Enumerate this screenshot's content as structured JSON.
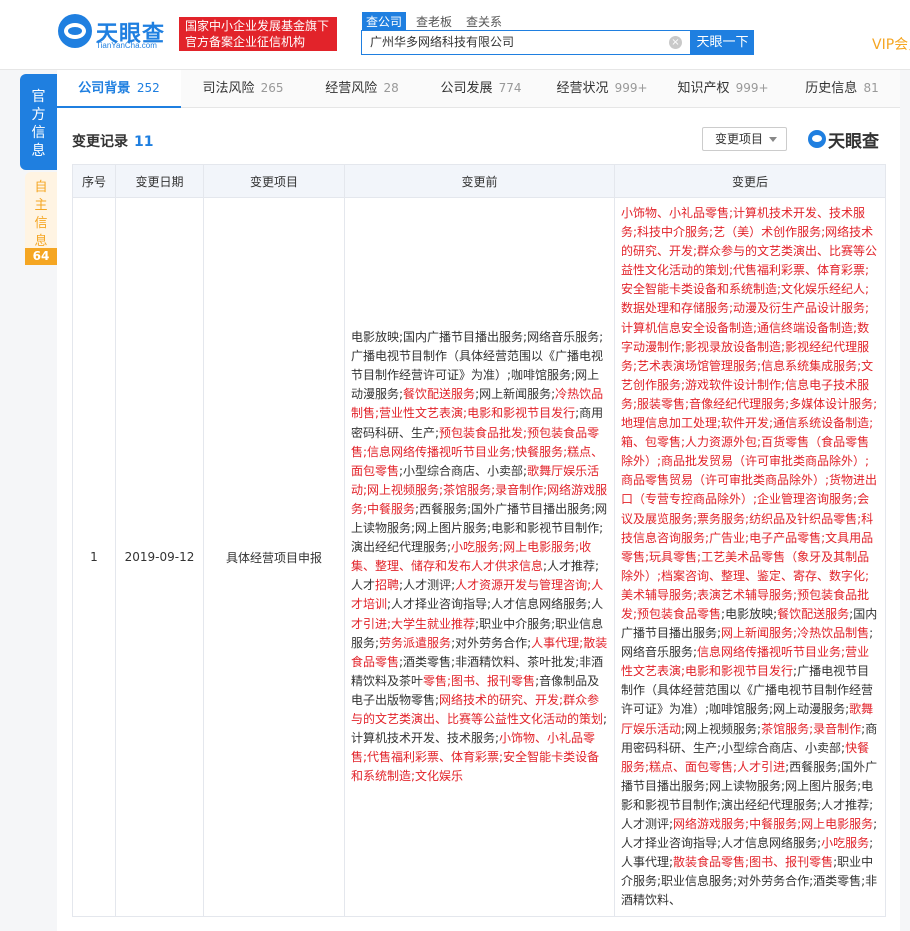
{
  "header": {
    "logo_text": "天眼查",
    "logo_sub": "TianYanCha.com",
    "badge_line1": "国家中小企业发展基金旗下",
    "badge_line2": "官方备案企业征信机构",
    "search_tabs": [
      "查公司",
      "查老板",
      "查关系"
    ],
    "search_value": "广州华多网络科技有限公司",
    "search_button": "天眼一下",
    "vip_label": "VIP会员"
  },
  "sidebar": {
    "official_label": "官方信息",
    "self_label": "自主信息",
    "self_count": "64"
  },
  "tabs": [
    {
      "label": "公司背景",
      "count": "252",
      "active": true
    },
    {
      "label": "司法风险",
      "count": "265"
    },
    {
      "label": "经营风险",
      "count": "28"
    },
    {
      "label": "公司发展",
      "count": "774"
    },
    {
      "label": "经营状况",
      "count": "999+"
    },
    {
      "label": "知识产权",
      "count": "999+"
    },
    {
      "label": "历史信息",
      "count": "81"
    }
  ],
  "section": {
    "title": "变更记录",
    "count": "11",
    "filter_label": "变更项目",
    "watermark": "天眼查"
  },
  "table": {
    "headers": [
      "序号",
      "变更日期",
      "变更项目",
      "变更前",
      "变更后"
    ],
    "rows": [
      {
        "index": "1",
        "date": "2019-09-12",
        "item": "具体经营项目申报",
        "before": [
          {
            "t": "电影放映;国内广播节目播出服务;网络音乐服务;广播电视节目制作（具体经营范围以《广播电视节目制作经营许可证》为准）;咖啡馆服务;网上动漫服务;",
            "h": false
          },
          {
            "t": "餐饮配送服务",
            "h": true
          },
          {
            "t": ";网上新闻服务;",
            "h": false
          },
          {
            "t": "冷热饮品制售;营业性文艺表演;电影和影视节目发行",
            "h": true
          },
          {
            "t": ";商用密码科研、生产;",
            "h": false
          },
          {
            "t": "预包装食品批发;预包装食品零售;信息网络传播视听节目业务;快餐服务;糕点、面包零售",
            "h": true
          },
          {
            "t": ";小型综合商店、小卖部;",
            "h": false
          },
          {
            "t": "歌舞厅娱乐活动;网上视频服务;茶馆服务;录音制作;网络游戏服务;中餐服务",
            "h": true
          },
          {
            "t": ";西餐服务;国外广播节目播出服务;网上读物服务;网上图片服务;电影和影视节目制作;演出经纪代理服务;",
            "h": false
          },
          {
            "t": "小吃服务;网上电影服务;收集、整理、储存和发布人才供求信息",
            "h": true
          },
          {
            "t": ";人才推荐;人才",
            "h": false
          },
          {
            "t": "招聘",
            "h": true
          },
          {
            "t": ";人才测评;",
            "h": false
          },
          {
            "t": "人才资源开发与管理咨询;人才培训",
            "h": true
          },
          {
            "t": ";人才择业咨询指导;人才信息网络服务;人",
            "h": false
          },
          {
            "t": "才引进;大学生就业推荐",
            "h": true
          },
          {
            "t": ";职业中介服务;职业信息服务;",
            "h": false
          },
          {
            "t": "劳务派遣服务",
            "h": true
          },
          {
            "t": ";对外劳务合作;",
            "h": false
          },
          {
            "t": "人事代理;散装食品零售",
            "h": true
          },
          {
            "t": ";酒类零售;非酒精饮料、茶叶批发;非酒精饮料及茶叶",
            "h": false
          },
          {
            "t": "零售;图书、报刊零售",
            "h": true
          },
          {
            "t": ";音像制品及电子出版物零售;",
            "h": false
          },
          {
            "t": "网络技术的研究、开发;群众参与的文艺类演出、比赛等公益性文化活动的策划",
            "h": true
          },
          {
            "t": ";计算机技术开发、技术服务;",
            "h": false
          },
          {
            "t": "小饰物、小礼品零售;代售福利彩票、体育彩票;安全智能卡类设备和系统制造;文化娱乐",
            "h": true
          }
        ],
        "after": [
          {
            "t": "小饰物、小礼品零售;计算机技术开发、技术服务;科技中介服务;艺（美）术创作服务;网络技术的研究、开发;群众参与的文艺类演出、比赛等公益性文化活动的策划;代售福利彩票、体育彩票;安全智能卡类设备和系统制造;文化娱乐经纪人;数据处理和存储服务;动漫及衍生产品设计服务;计算机信息安全设备制造;通信终端设备制造;数字动漫制作;影视录放设备制造;影视经纪代理服务;艺术表演场馆管理服务;信息系统集成服务;文艺创作服务;游戏软件设计制作;信息电子技术服务;服装零售;音像经纪代理服务;多媒体设计服务;地理信息加工处理;软件开发;通信系统设备制造;箱、包零售;人力资源外包;百货零售（食品零售除外）;商品批发贸易（许可审批类商品除外）;商品零售贸易（许可审批类商品除外）;货物进出口（专营专控商品除外）;企业管理咨询服务;会议及展览服务;票务服务;纺织品及针织品零售;科技信息咨询服务;广告业;电子产品零售;文具用品零售;玩具零售;工艺美术品零售（象牙及其制品除外）;档案咨询、整理、鉴定、寄存、数字化;美术辅导服务;表演艺术辅导服务;预包装食品批发;预包装食品零售",
            "h": true
          },
          {
            "t": ";电影放映;",
            "h": false
          },
          {
            "t": "餐饮配送服务",
            "h": true
          },
          {
            "t": ";国内广播节目播出服务;",
            "h": false
          },
          {
            "t": "网上新闻服务;冷热饮品制售",
            "h": true
          },
          {
            "t": ";网络音乐服务;",
            "h": false
          },
          {
            "t": "信息网络传播视听节目业务;营业性文艺表演;电影和影视节目发行",
            "h": true
          },
          {
            "t": ";广播电视节目制作（具体经营范围以《广播电视节目制作经营许可证》为准）;咖啡馆服务;网上动漫服务;",
            "h": false
          },
          {
            "t": "歌舞厅娱乐活动",
            "h": true
          },
          {
            "t": ";网上视频服务;",
            "h": false
          },
          {
            "t": "茶馆服务;录音制作",
            "h": true
          },
          {
            "t": ";商用密码科研、生产;小型综合商店、小卖部;",
            "h": false
          },
          {
            "t": "快餐服务;糕点、面包零售;人才引进",
            "h": true
          },
          {
            "t": ";西餐服务;国外广播节目播出服务;网上读物服务;网上图片服务;电影和影视节目制作;演出经纪代理服务;人才推荐;人才测评;",
            "h": false
          },
          {
            "t": "网络游戏服务;中餐服务;网上电影服务",
            "h": true
          },
          {
            "t": ";人才择业咨询指导;人才信息网络服务;",
            "h": false
          },
          {
            "t": "小吃服务",
            "h": true
          },
          {
            "t": ";人事代理;",
            "h": false
          },
          {
            "t": "散装食品零售;图书、报刊零售",
            "h": true
          },
          {
            "t": ";职业中介服务;职业信息服务;对外劳务合作;酒类零售;非酒精饮料、",
            "h": false
          }
        ]
      }
    ]
  }
}
